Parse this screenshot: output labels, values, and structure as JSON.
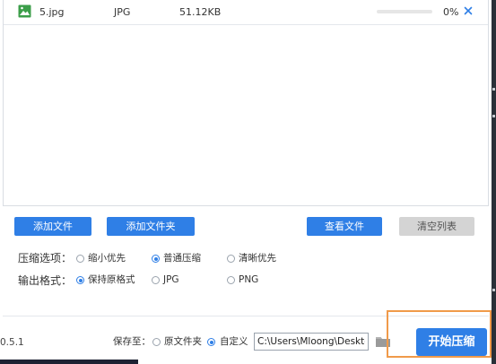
{
  "file_list": {
    "rows": [
      {
        "name": "5.jpg",
        "type": "JPG",
        "size": "51.12KB",
        "progress_fraction": 0.0,
        "percent": "0%"
      }
    ]
  },
  "toolbar": {
    "add_file": "添加文件",
    "add_folder": "添加文件夹",
    "view_file": "查看文件",
    "clear_list": "清空列表"
  },
  "compress_options": {
    "label": "压缩选项：",
    "options": [
      "缩小优先",
      "普通压缩",
      "清晰优先"
    ],
    "selected_index": 1
  },
  "output_format": {
    "label": "输出格式：",
    "options": [
      "保持原格式",
      "JPG",
      "PNG"
    ],
    "selected_index": 0
  },
  "save_to": {
    "label": "保存至：",
    "options": [
      "原文件夹",
      "自定义"
    ],
    "selected_index": 1,
    "path": "C:\\Users\\Mloong\\Desktop"
  },
  "version": "0.5.1",
  "start_button": "开始压缩",
  "colors": {
    "accent": "#2f7fe6",
    "highlight_border": "#f09a4a",
    "disabled_button": "#d4d4d4"
  }
}
